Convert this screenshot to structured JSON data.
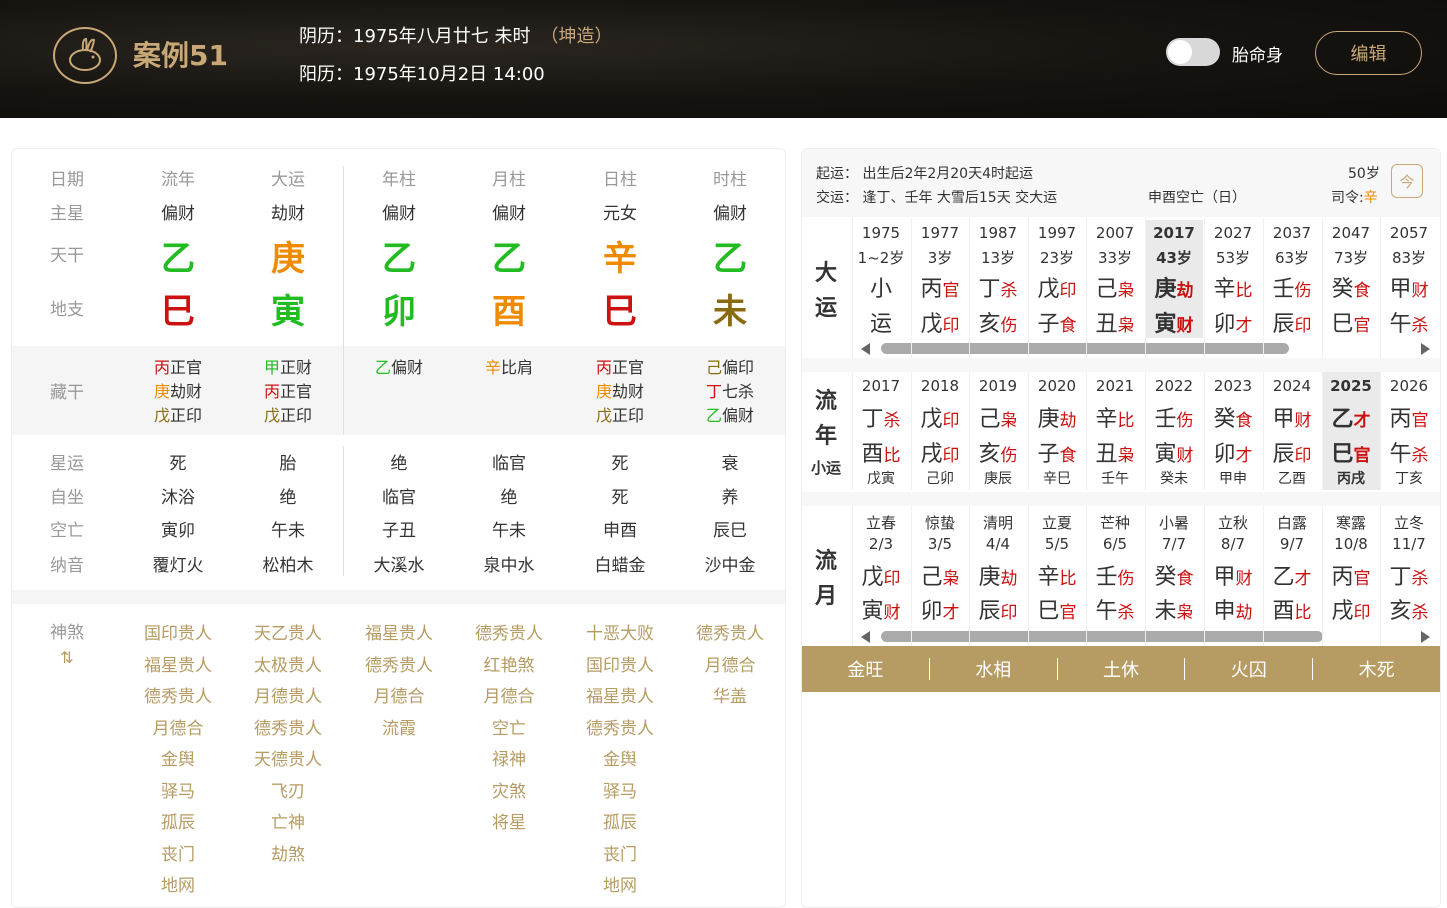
{
  "header": {
    "title": "案例51",
    "lunar": "阴历：1975年八月廿七 未时",
    "gender": "（坤造）",
    "solar": "阳历：1975年10月2日 14:00",
    "toggle_label": "胎命身",
    "edit_label": "编辑"
  },
  "colors": {
    "wood": "#22bb22",
    "fire": "#cc1111",
    "earth": "#8a6a10",
    "metal": "#f08a00",
    "gold": "#c9a877",
    "shensha": "#b69b63"
  },
  "pillars": {
    "row_labels": [
      "日期",
      "主星",
      "天干",
      "地支",
      "藏干",
      "星运",
      "自坐",
      "空亡",
      "纳音",
      "神煞"
    ],
    "cols": [
      {
        "head": "流年",
        "main": "偏财",
        "gan": "乙",
        "zhi": "巳",
        "canggan": [
          [
            "丙",
            "正官"
          ],
          [
            "庚",
            "劫财"
          ],
          [
            "戊",
            "正印"
          ]
        ],
        "xingyun": "死",
        "zizuo": "沐浴",
        "kongwang": "寅卯",
        "nayin": "覆灯火",
        "shensha": [
          "国印贵人",
          "福星贵人",
          "德秀贵人",
          "月德合",
          "金舆",
          "驿马",
          "孤辰",
          "丧门",
          "地网"
        ]
      },
      {
        "head": "大运",
        "main": "劫财",
        "gan": "庚",
        "zhi": "寅",
        "canggan": [
          [
            "甲",
            "正财"
          ],
          [
            "丙",
            "正官"
          ],
          [
            "戊",
            "正印"
          ]
        ],
        "xingyun": "胎",
        "zizuo": "绝",
        "kongwang": "午未",
        "nayin": "松柏木",
        "shensha": [
          "天乙贵人",
          "太极贵人",
          "月德贵人",
          "德秀贵人",
          "天德贵人",
          "飞刃",
          "亡神",
          "劫煞"
        ]
      },
      {
        "head": "年柱",
        "main": "偏财",
        "gan": "乙",
        "zhi": "卯",
        "canggan": [
          [
            "乙",
            "偏财"
          ]
        ],
        "xingyun": "绝",
        "zizuo": "临官",
        "kongwang": "子丑",
        "nayin": "大溪水",
        "shensha": [
          "福星贵人",
          "德秀贵人",
          "月德合",
          "流霞"
        ]
      },
      {
        "head": "月柱",
        "main": "偏财",
        "gan": "乙",
        "zhi": "酉",
        "canggan": [
          [
            "辛",
            "比肩"
          ]
        ],
        "xingyun": "临官",
        "zizuo": "绝",
        "kongwang": "午未",
        "nayin": "泉中水",
        "shensha": [
          "德秀贵人",
          "红艳煞",
          "月德合",
          "空亡",
          "禄神",
          "灾煞",
          "将星"
        ]
      },
      {
        "head": "日柱",
        "main": "元女",
        "gan": "辛",
        "zhi": "巳",
        "canggan": [
          [
            "丙",
            "正官"
          ],
          [
            "庚",
            "劫财"
          ],
          [
            "戊",
            "正印"
          ]
        ],
        "xingyun": "死",
        "zizuo": "死",
        "kongwang": "申酉",
        "nayin": "白蜡金",
        "shensha": [
          "十恶大败",
          "国印贵人",
          "福星贵人",
          "德秀贵人",
          "金舆",
          "驿马",
          "孤辰",
          "丧门",
          "地网"
        ]
      },
      {
        "head": "时柱",
        "main": "偏财",
        "gan": "乙",
        "zhi": "未",
        "canggan": [
          [
            "己",
            "偏印"
          ],
          [
            "丁",
            "七杀"
          ],
          [
            "乙",
            "偏财"
          ]
        ],
        "xingyun": "衰",
        "zizuo": "养",
        "kongwang": "辰巳",
        "nayin": "沙中金",
        "shensha": [
          "德秀贵人",
          "月德合",
          "华盖"
        ]
      }
    ],
    "shensha_toggle": "⇅"
  },
  "info": {
    "qiyun": "起运： 出生后2年2月20天4时起运",
    "jiaoyun": "交运： 逢丁、壬年 大雪后15天 交大运",
    "kongwang": "申酉空亡（日）",
    "age": "50岁",
    "siling_label": "司令:",
    "siling": "辛",
    "calendar_icon": "今"
  },
  "dayun": {
    "label": [
      "大",
      "运"
    ],
    "cols": [
      {
        "y": "1975",
        "a": "1~2岁",
        "g": "小",
        "gs": "",
        "z": "运",
        "zs": ""
      },
      {
        "y": "1977",
        "a": "3岁",
        "g": "丙",
        "gs": "官",
        "z": "戊",
        "zs": "印"
      },
      {
        "y": "1987",
        "a": "13岁",
        "g": "丁",
        "gs": "杀",
        "z": "亥",
        "zs": "伤"
      },
      {
        "y": "1997",
        "a": "23岁",
        "g": "戊",
        "gs": "印",
        "z": "子",
        "zs": "食"
      },
      {
        "y": "2007",
        "a": "33岁",
        "g": "己",
        "gs": "枭",
        "z": "丑",
        "zs": "枭"
      },
      {
        "y": "2017",
        "a": "43岁",
        "g": "庚",
        "gs": "劫",
        "z": "寅",
        "zs": "财"
      },
      {
        "y": "2027",
        "a": "53岁",
        "g": "辛",
        "gs": "比",
        "z": "卯",
        "zs": "才"
      },
      {
        "y": "2037",
        "a": "63岁",
        "g": "壬",
        "gs": "伤",
        "z": "辰",
        "zs": "印"
      },
      {
        "y": "2047",
        "a": "73岁",
        "g": "癸",
        "gs": "食",
        "z": "巳",
        "zs": "官"
      },
      {
        "y": "2057",
        "a": "83岁",
        "g": "甲",
        "gs": "财",
        "z": "午",
        "zs": "杀"
      }
    ],
    "active": 5
  },
  "liunian": {
    "label": [
      "流",
      "年"
    ],
    "sub": "小运",
    "cols": [
      {
        "y": "2017",
        "g": "丁",
        "gs": "杀",
        "z": "酉",
        "zs": "比",
        "x": "戊寅"
      },
      {
        "y": "2018",
        "g": "戊",
        "gs": "印",
        "z": "戌",
        "zs": "印",
        "x": "己卯"
      },
      {
        "y": "2019",
        "g": "己",
        "gs": "枭",
        "z": "亥",
        "zs": "伤",
        "x": "庚辰"
      },
      {
        "y": "2020",
        "g": "庚",
        "gs": "劫",
        "z": "子",
        "zs": "食",
        "x": "辛巳"
      },
      {
        "y": "2021",
        "g": "辛",
        "gs": "比",
        "z": "丑",
        "zs": "枭",
        "x": "壬午"
      },
      {
        "y": "2022",
        "g": "壬",
        "gs": "伤",
        "z": "寅",
        "zs": "财",
        "x": "癸未"
      },
      {
        "y": "2023",
        "g": "癸",
        "gs": "食",
        "z": "卯",
        "zs": "才",
        "x": "甲申"
      },
      {
        "y": "2024",
        "g": "甲",
        "gs": "财",
        "z": "辰",
        "zs": "印",
        "x": "乙酉"
      },
      {
        "y": "2025",
        "g": "乙",
        "gs": "才",
        "z": "巳",
        "zs": "官",
        "x": "丙戌"
      },
      {
        "y": "2026",
        "g": "丙",
        "gs": "官",
        "z": "午",
        "zs": "杀",
        "x": "丁亥"
      }
    ],
    "active": 8
  },
  "liuyue": {
    "label": [
      "流",
      "月"
    ],
    "cols": [
      {
        "t": "立春",
        "d": "2/3",
        "g": "戊",
        "gs": "印",
        "z": "寅",
        "zs": "财"
      },
      {
        "t": "惊蛰",
        "d": "3/5",
        "g": "己",
        "gs": "枭",
        "z": "卯",
        "zs": "才"
      },
      {
        "t": "清明",
        "d": "4/4",
        "g": "庚",
        "gs": "劫",
        "z": "辰",
        "zs": "印"
      },
      {
        "t": "立夏",
        "d": "5/5",
        "g": "辛",
        "gs": "比",
        "z": "巳",
        "zs": "官"
      },
      {
        "t": "芒种",
        "d": "6/5",
        "g": "壬",
        "gs": "伤",
        "z": "午",
        "zs": "杀"
      },
      {
        "t": "小暑",
        "d": "7/7",
        "g": "癸",
        "gs": "食",
        "z": "未",
        "zs": "枭"
      },
      {
        "t": "立秋",
        "d": "8/7",
        "g": "甲",
        "gs": "财",
        "z": "申",
        "zs": "劫"
      },
      {
        "t": "白露",
        "d": "9/7",
        "g": "乙",
        "gs": "才",
        "z": "酉",
        "zs": "比"
      },
      {
        "t": "寒露",
        "d": "10/8",
        "g": "丙",
        "gs": "官",
        "z": "戌",
        "zs": "印"
      },
      {
        "t": "立冬",
        "d": "11/7",
        "g": "丁",
        "gs": "杀",
        "z": "亥",
        "zs": "杀"
      }
    ]
  },
  "wuxing": [
    "金旺",
    "水相",
    "土休",
    "火囚",
    "木死"
  ]
}
